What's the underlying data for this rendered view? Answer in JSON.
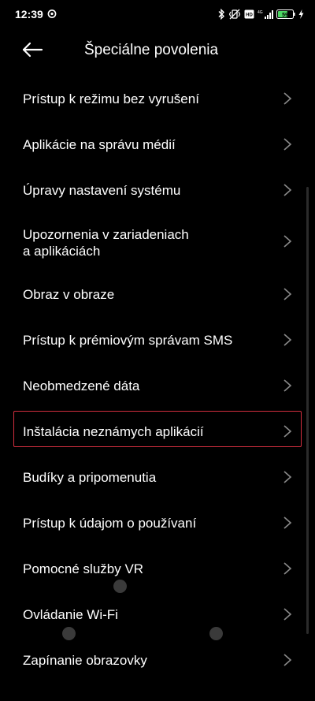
{
  "status_bar": {
    "time": "12:39",
    "battery_level": "59"
  },
  "header": {
    "title": "Špeciálne povolenia"
  },
  "items": [
    {
      "label": "Prístup k režimu bez vyrušení"
    },
    {
      "label": "Aplikácie na správu médií"
    },
    {
      "label": "Úpravy nastavení systému"
    },
    {
      "label": "Upozornenia v zariadeniach",
      "label2": "a aplikáciách"
    },
    {
      "label": "Obraz v obraze"
    },
    {
      "label": "Prístup k prémiovým správam SMS"
    },
    {
      "label": "Neobmedzené dáta"
    },
    {
      "label": "Inštalácia neznámych aplikácií"
    },
    {
      "label": "Budíky a pripomenutia"
    },
    {
      "label": "Prístup k údajom o používaní"
    },
    {
      "label": "Pomocné služby VR"
    },
    {
      "label": "Ovládanie Wi-Fi"
    },
    {
      "label": "Zapínanie obrazovky"
    }
  ],
  "highlight_color": "#d32f3f",
  "icons": {
    "back": "arrow-left-icon",
    "chevron": "chevron-right-icon"
  }
}
